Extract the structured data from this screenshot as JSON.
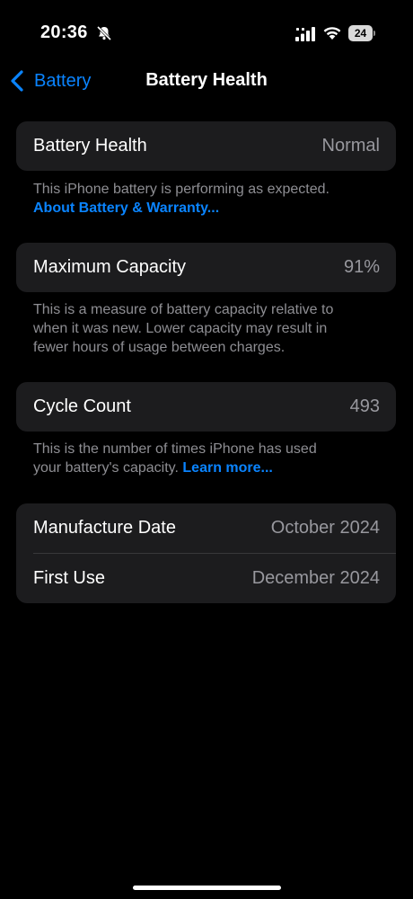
{
  "status_bar": {
    "time": "20:36",
    "battery_level": "24",
    "icons": [
      "bell-slash-icon",
      "cellular-signal-icon",
      "wifi-icon",
      "battery-icon"
    ]
  },
  "nav": {
    "back_label": "Battery",
    "title": "Battery Health",
    "back_icon": "chevron-left-icon"
  },
  "health": {
    "label": "Battery Health",
    "value": "Normal",
    "footnote": "This iPhone battery is performing as expected.",
    "link": "About Battery & Warranty..."
  },
  "capacity": {
    "label": "Maximum Capacity",
    "value": "91%",
    "footnote_line1": "This is a measure of battery capacity relative to",
    "footnote_line2": "when it was new. Lower capacity may result in",
    "footnote_line3": "fewer hours of usage between charges."
  },
  "cycle": {
    "label": "Cycle Count",
    "value": "493",
    "footnote_line1": "This is the number of times iPhone has used",
    "footnote_line2": "your battery's capacity.",
    "link": "Learn more..."
  },
  "dates": {
    "manufacture_label": "Manufacture Date",
    "manufacture_value": "October 2024",
    "first_use_label": "First Use",
    "first_use_value": "December 2024"
  },
  "colors": {
    "accent": "#0a84ff",
    "background": "#000000",
    "card": "#1c1c1e",
    "secondary_text": "#8e8e93"
  }
}
